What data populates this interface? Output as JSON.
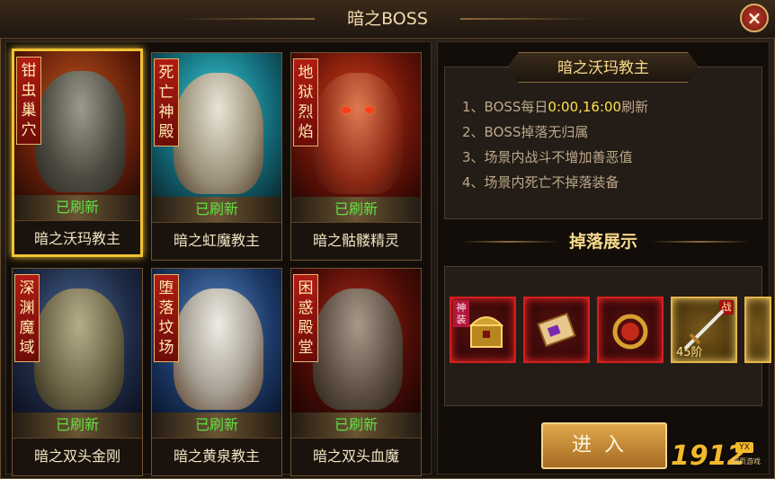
{
  "window": {
    "title": "暗之BOSS",
    "close_label": "×"
  },
  "bosses": [
    {
      "banner": "钳虫巢穴",
      "status": "已刷新",
      "name": "暗之沃玛教主",
      "selected": true
    },
    {
      "banner": "死亡神殿",
      "status": "已刷新",
      "name": "暗之虹魔教主",
      "selected": false
    },
    {
      "banner": "地狱烈焰",
      "status": "已刷新",
      "name": "暗之骷髅精灵",
      "selected": false
    },
    {
      "banner": "深渊魔域",
      "status": "已刷新",
      "name": "暗之双头金刚",
      "selected": false
    },
    {
      "banner": "堕落坟场",
      "status": "已刷新",
      "name": "暗之黄泉教主",
      "selected": false
    },
    {
      "banner": "困惑殿堂",
      "status": "已刷新",
      "name": "暗之双头血魔",
      "selected": false
    }
  ],
  "detail": {
    "boss_title": "暗之沃玛教主",
    "rules": [
      {
        "prefix": "1、BOSS每日",
        "highlight": "0:00,16:00",
        "suffix": "刷新"
      },
      {
        "prefix": "2、BOSS掉落无归属",
        "highlight": "",
        "suffix": ""
      },
      {
        "prefix": "3、场景内战斗不增加善恶值",
        "highlight": "",
        "suffix": ""
      },
      {
        "prefix": "4、场景内死亡不掉落装备",
        "highlight": "",
        "suffix": ""
      }
    ],
    "drops_title": "掉落展示",
    "drops": [
      {
        "icon": "treasure-chest-icon",
        "tag": "神装",
        "level": "",
        "corner": ""
      },
      {
        "icon": "scroll-icon",
        "tag": "",
        "level": "",
        "corner": ""
      },
      {
        "icon": "ring-icon",
        "tag": "",
        "level": "",
        "corner": ""
      },
      {
        "icon": "sword-icon",
        "tag": "",
        "level": "45阶",
        "corner": "战"
      }
    ]
  },
  "enter_label": "进入",
  "watermark": {
    "number": "1912",
    "badge": "YX",
    "sub": "网页游戏"
  },
  "colors": {
    "accent": "#f1c232",
    "status_green": "#5fe244",
    "highlight": "#ffe14d"
  }
}
